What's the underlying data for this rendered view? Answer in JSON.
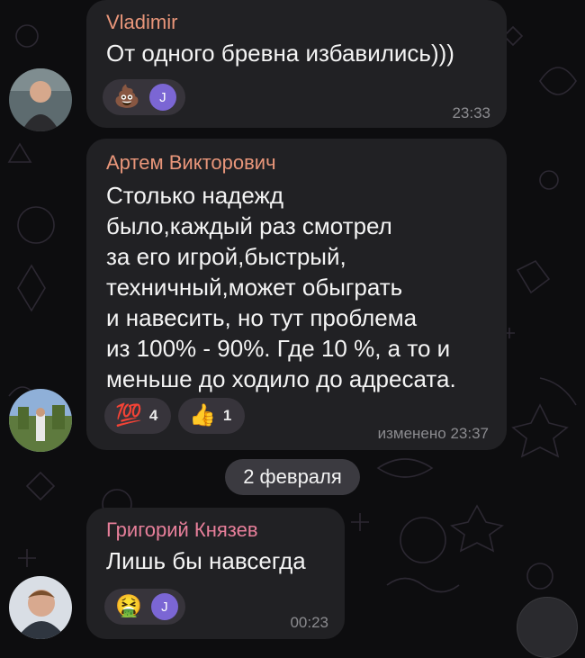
{
  "colors": {
    "background": "#0d0d0f",
    "bubble": "#212124",
    "sender_vladimir": "#e9967a",
    "sender_artem": "#e9967a",
    "sender_grigoriy": "#e77f9a",
    "time": "#8b8b8f",
    "reaction_bg": "#37343b",
    "reaction_avatar": "#7b66d4"
  },
  "messages": [
    {
      "sender": "Vladimir",
      "text": "От одного бревна избавились)))",
      "time": "23:33",
      "reactions": [
        {
          "icon": "pile-of-poo",
          "glyph": "💩",
          "avatar": "J"
        }
      ]
    },
    {
      "sender": "Артем Викторович",
      "text": "Столько надежд\nбыло,каждый раз смотрел\nза его игрой,быстрый,\nтехничный,может обыграть\nи навесить, но тут проблема\nиз 100% - 90%. Где 10 %, а то и\nменьше до ходило до адресата.",
      "time": "изменено 23:37",
      "reactions": [
        {
          "icon": "hundred-points",
          "glyph": "💯",
          "count": "4"
        },
        {
          "icon": "thumbs-up",
          "glyph": "👍",
          "count": "1"
        }
      ]
    },
    {
      "sender": "Григорий Князев",
      "text": "Лишь бы навсегда",
      "time": "00:23",
      "reactions": [
        {
          "icon": "face-vomiting",
          "glyph": "🤮",
          "avatar": "J"
        }
      ]
    }
  ],
  "date_separator": "2 февраля"
}
